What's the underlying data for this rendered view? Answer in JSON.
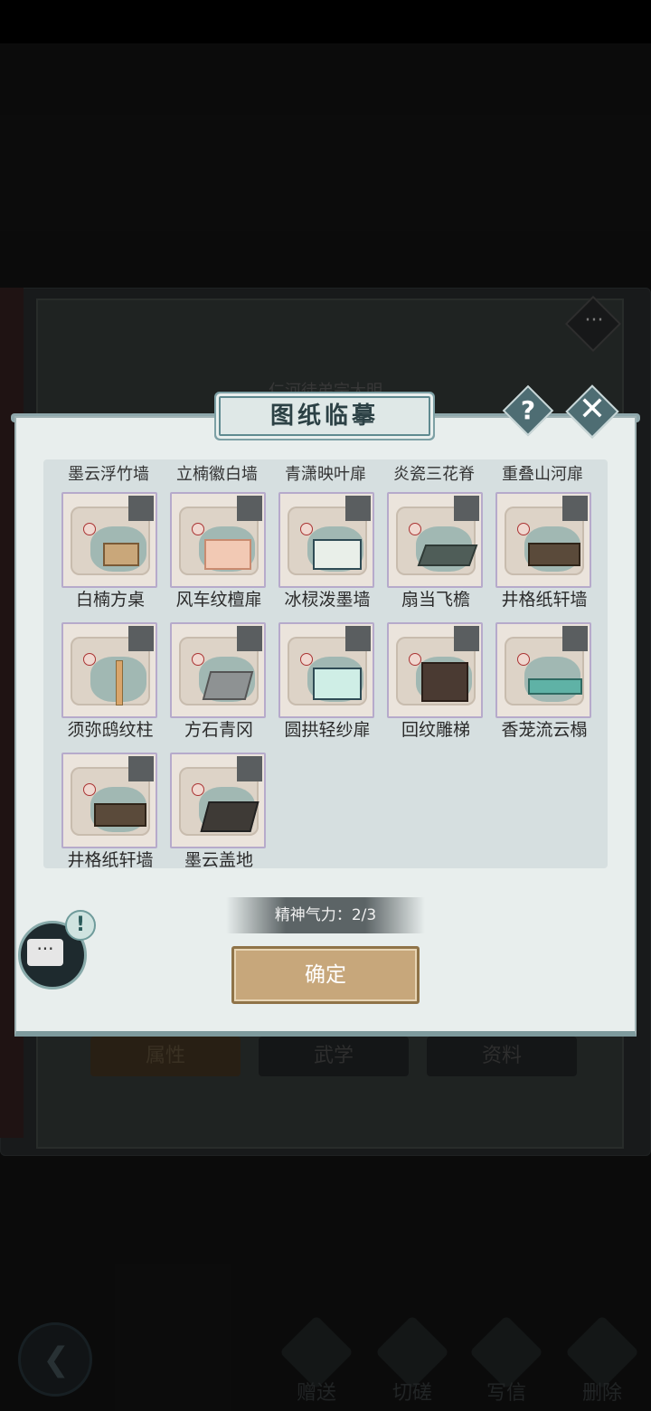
{
  "book": {
    "header": "仁河徒弟宗大明",
    "tabs": [
      "属性",
      "武学",
      "资料"
    ]
  },
  "actions": [
    {
      "label": "赠送",
      "icon": "gift-scroll-icon"
    },
    {
      "label": "切磋",
      "icon": "sword-icon"
    },
    {
      "label": "写信",
      "icon": "letter-icon"
    },
    {
      "label": "删除",
      "icon": "trash-icon"
    }
  ],
  "dialog": {
    "title": "图纸临摹",
    "help": "?",
    "close": "✕",
    "partial_row": [
      "墨云浮竹墙",
      "立楠徽白墙",
      "青潇映叶扉",
      "炎瓷三花脊",
      "重叠山河扉"
    ],
    "items": [
      {
        "name": "白楠方桌",
        "kind": "table"
      },
      {
        "name": "风车纹檀扉",
        "kind": "door-pink"
      },
      {
        "name": "冰棂泼墨墙",
        "kind": "wall-window"
      },
      {
        "name": "扇当飞檐",
        "kind": "roof"
      },
      {
        "name": "井格纸轩墙",
        "kind": "wall"
      },
      {
        "name": "须弥鸱纹柱",
        "kind": "pillar"
      },
      {
        "name": "方石青冈",
        "kind": "floor-grey"
      },
      {
        "name": "圆拱轻纱扉",
        "kind": "arch-door"
      },
      {
        "name": "回纹雕梯",
        "kind": "stair"
      },
      {
        "name": "香茏流云榻",
        "kind": "bed"
      },
      {
        "name": "井格纸轩墙",
        "kind": "wall"
      },
      {
        "name": "墨云盖地",
        "kind": "floor-dark"
      }
    ],
    "energy_label": "精神气力：",
    "energy_value": "2/3",
    "confirm_label": "确定"
  },
  "chat": {
    "alert": "!",
    "bubble": "···"
  },
  "book_more": "···",
  "back_icon": "back-arrow-icon"
}
